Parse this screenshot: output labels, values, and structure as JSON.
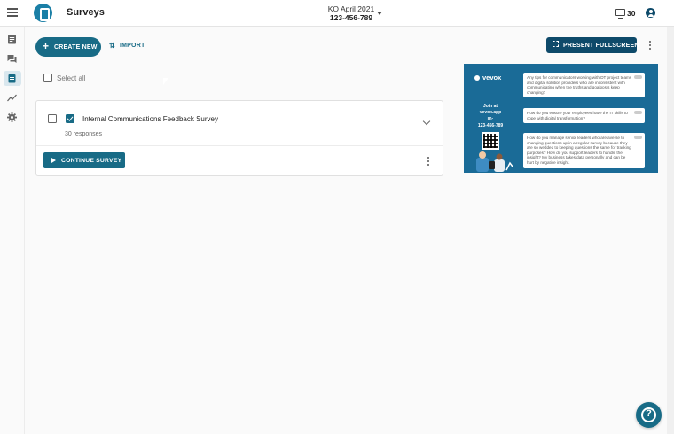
{
  "header": {
    "page_title": "Surveys",
    "event_name": "KO April 2021",
    "event_code": "123-456-789",
    "participant_count": "30",
    "icons": [
      "hamburger-icon",
      "logo-icon",
      "chevron-down-icon",
      "screen-icon",
      "account-icon"
    ]
  },
  "sidebar": {
    "items": [
      {
        "name": "questions-icon",
        "active": false
      },
      {
        "name": "messages-icon",
        "active": false
      },
      {
        "name": "surveys-icon",
        "active": true
      },
      {
        "name": "analytics-icon",
        "active": false
      },
      {
        "name": "settings-icon",
        "active": false
      }
    ]
  },
  "toolbar": {
    "create_label": "CREATE NEW",
    "import_label": "IMPORT",
    "present_label": "PRESENT FULLSCREEN"
  },
  "list": {
    "select_all_label": "Select all",
    "surveys": [
      {
        "title": "Internal Communications Feedback Survey",
        "responses": "30 responses",
        "checked": true,
        "action_label": "CONTINUE SURVEY"
      }
    ]
  },
  "preview": {
    "brand": "vevox",
    "join_line1": "Join at",
    "join_line2": "vevox.app",
    "join_line3": "ID:",
    "join_line4": "123-456-789",
    "questions": [
      "Any tips for communicators working with DT project teams and digital solution providers who are inconsistent with communicating when the truths and goalposts keep changing?",
      "How do you ensure your employees have the IT skills to cope with digital transformation?",
      "How do you manage senior leaders who are averse to changing questions up in a regular survey because they are so wedded to keeping questions the same for tracking purposes? How do you support leaders to handle the insight? My business takes data personally and can be hurt by negative insight."
    ]
  },
  "colors": {
    "primary": "#186b86",
    "dark": "#0e4a6a",
    "preview_bg": "#1a6b97"
  }
}
